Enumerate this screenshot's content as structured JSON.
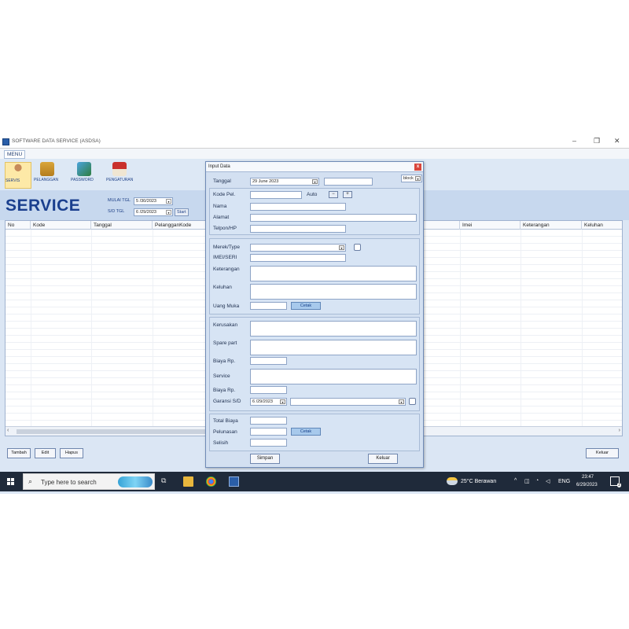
{
  "window": {
    "title": "SOFTWARE DATA SERVICE (ASDSA)",
    "minimize": "–",
    "maximize": "❐",
    "close": "✕"
  },
  "menu": {
    "label": "MENU"
  },
  "ribbon": [
    {
      "label": "SERVIS",
      "icon": "person-icon"
    },
    {
      "label": "PELANGGAN",
      "icon": "folder-icon"
    },
    {
      "label": "PASSWORD",
      "icon": "monitor-icon"
    },
    {
      "label": "PENGATURAN",
      "icon": "house-icon"
    }
  ],
  "header": {
    "title": "SERVICE",
    "mulai_label": "MULAI TGL",
    "mulai_value": "5 /30/2023",
    "sd_label": "S/D TGL",
    "sd_value": "6 /29/2023",
    "start_label": "Start"
  },
  "table": {
    "columns": [
      "No",
      "Kode",
      "Tanggal",
      "PelangganKode",
      "",
      "Imei",
      "Keterangan",
      "Keluhan"
    ]
  },
  "buttons": {
    "tambah": "Tambah",
    "edit": "Edit",
    "hapus": "Hapus",
    "keluar": "Keluar"
  },
  "dialog": {
    "title": "Input Data",
    "close": "x",
    "tanggal_label": "Tanggal",
    "tanggal_value": "29 June 2023",
    "block_value": "block",
    "kode_pel_label": "Kode Pel.",
    "auto_label": "Auto",
    "nama_label": "Nama",
    "alamat_label": "Alamat",
    "telpon_label": "Telpon/HP",
    "merek_label": "Merek/Type",
    "imei_label": "IMEI/SERI",
    "keterangan_label": "Keterangan",
    "keluhan_label": "Keluhan",
    "uang_muka_label": "Uang Muka",
    "cetak1": "Cetak",
    "kerusakan_label": "Kerusakan",
    "spare_part_label": "Spare part",
    "biaya1_label": "Biaya Rp.",
    "service_label": "Service",
    "biaya2_label": "Biaya Rp.",
    "garansi_label": "Garansi S/D",
    "garansi_value": "6 /29/2023",
    "total_label": "Total Biaya",
    "pelunasan_label": "Pelunasan",
    "cetak2": "Cetak",
    "selisih_label": "Selisih",
    "simpan": "Simpan",
    "keluar": "Keluar"
  },
  "taskbar": {
    "search_placeholder": "Type here to search",
    "weather": "25°C  Berawan",
    "lang": "ENG",
    "time": "23:47",
    "date": "6/29/2023",
    "notif_count": "2"
  }
}
